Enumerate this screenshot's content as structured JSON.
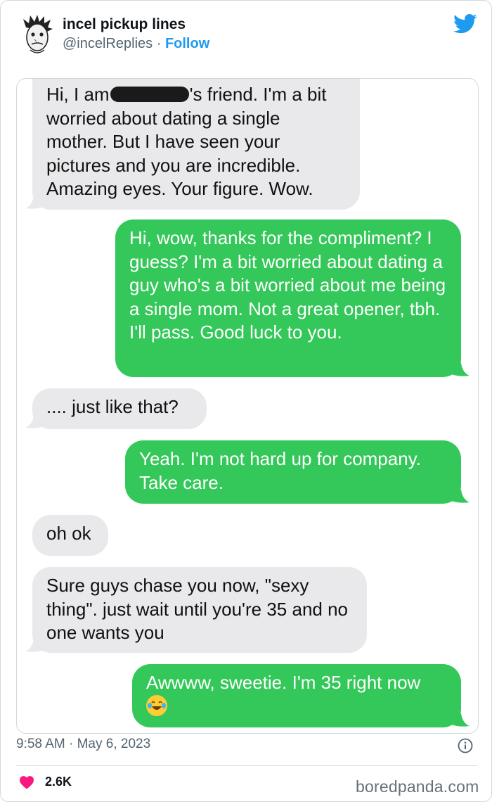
{
  "post": {
    "author_name": "incel pickup lines",
    "author_handle": "@incelReplies",
    "separator": "·",
    "follow_label": "Follow",
    "timestamp": "9:58 AM · May 6, 2023",
    "likes": "2.6K"
  },
  "conversation": {
    "m1_before": "Hi, I am",
    "m1_after": "'s friend. I'm a bit worried about dating a single mother. But I have seen your pictures and you are incredible. Amazing eyes. Your figure. Wow.",
    "m2": "Hi, wow, thanks for the compliment? I guess? I'm a bit worried about dating a guy who's a bit worried about me being a single mom. Not a great opener, tbh. I'll pass. Good luck to you.",
    "m3": ".... just like that?",
    "m4": "Yeah. I'm not hard up for company. Take care.",
    "m5": "oh ok",
    "m6": "Sure guys chase you now, \"sexy thing\". just wait until you're 35 and no one wants you",
    "m7": "Awwww, sweetie. I'm 35 right now"
  },
  "watermark": "boredpanda.com",
  "colors": {
    "incoming_bubble": "#e9e9eb",
    "outgoing_bubble": "#34c759",
    "twitter_blue": "#1d9bf0",
    "heart": "#f91880"
  },
  "icons": [
    "avatar",
    "twitter-bird-icon",
    "info-icon",
    "heart-icon",
    "laughing-emoji-icon"
  ]
}
